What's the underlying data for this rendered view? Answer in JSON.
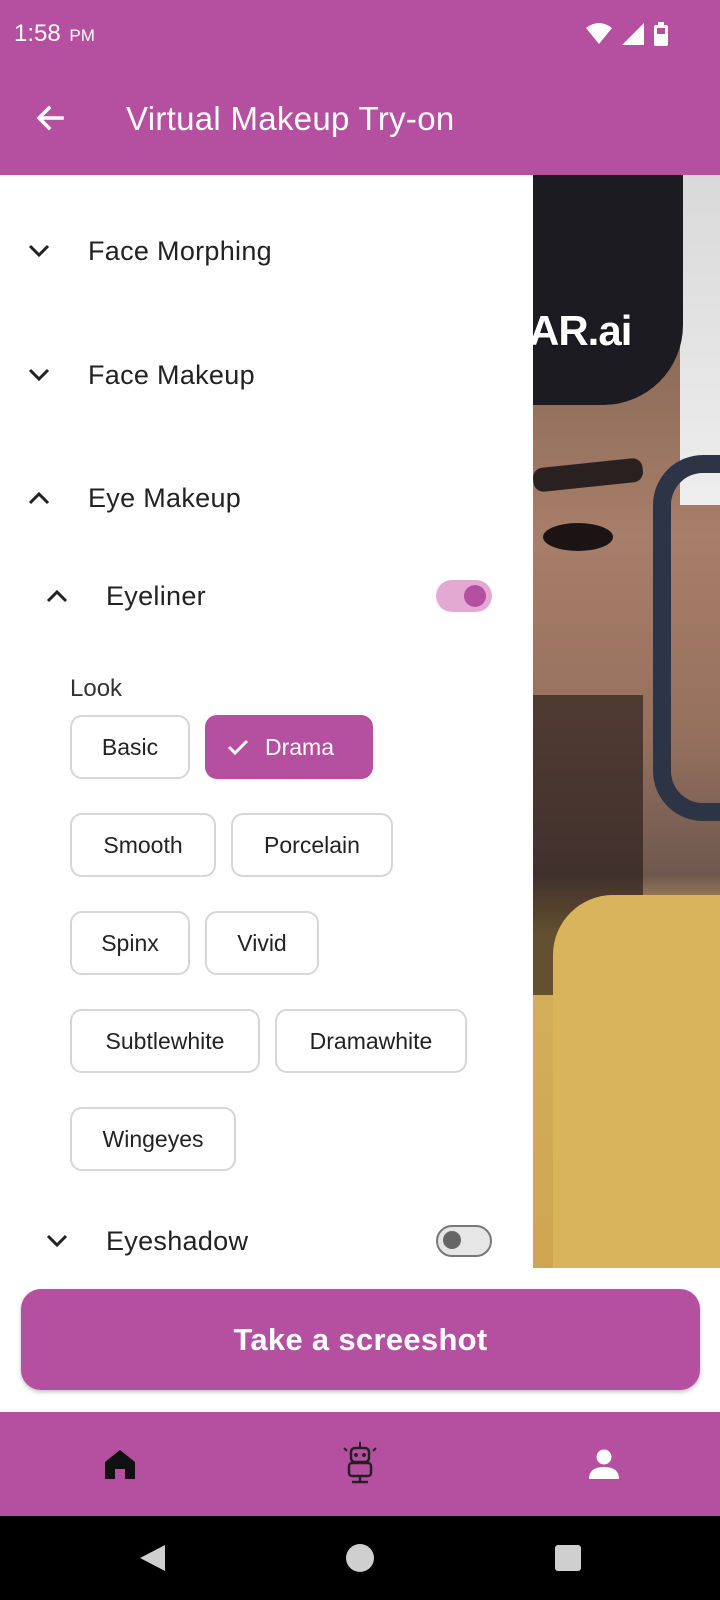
{
  "status_bar": {
    "time": "1:58",
    "ampm": "PM"
  },
  "app_bar": {
    "title": "Virtual Makeup Try-on"
  },
  "sections": [
    {
      "label": "Face Morphing",
      "expanded": false
    },
    {
      "label": "Face Makeup",
      "expanded": false
    },
    {
      "label": "Eye Makeup",
      "expanded": true
    }
  ],
  "eyeliner": {
    "label": "Eyeliner",
    "enabled": true,
    "look_label": "Look",
    "looks": [
      "Basic",
      "Drama",
      "Smooth",
      "Porcelain",
      "Spinx",
      "Vivid",
      "Subtlewhite",
      "Dramawhite",
      "Wingeyes"
    ],
    "selected": "Drama"
  },
  "eyeshadow": {
    "label": "Eyeshadow",
    "enabled": false
  },
  "camera": {
    "watermark": "AR.ai"
  },
  "action": {
    "screenshot_label": "Take a screeshot"
  },
  "bottom_nav": {
    "items": [
      {
        "icon": "home-icon"
      },
      {
        "icon": "robot-icon"
      },
      {
        "icon": "person-icon"
      }
    ]
  },
  "colors": {
    "accent": "#b54fa0",
    "toggle_track_on": "#e4a9d3"
  }
}
